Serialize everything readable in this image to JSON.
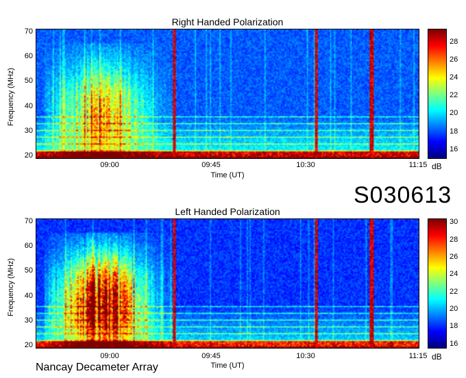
{
  "station": "Nancay Decameter Array",
  "observation_id": "S030613",
  "chart_data": [
    {
      "type": "heatmap",
      "title": "Right Handed Polarization",
      "xlabel": "Time (UT)",
      "ylabel": "Frequency (MHz)",
      "xticks": [
        "09:00",
        "09:45",
        "10:30",
        "11:15"
      ],
      "yticks": [
        20,
        30,
        40,
        50,
        60,
        70
      ],
      "ylim": [
        20,
        70
      ],
      "colorbar_unit": "dB",
      "colorbar_ticks": [
        16,
        18,
        20,
        22,
        24,
        26,
        28
      ],
      "color_range": [
        15,
        29.5
      ],
      "colormap": "jet",
      "bright_lines_time": [
        "09:25",
        "10:29",
        "10:54"
      ],
      "emission_band_mhz": [
        20,
        60
      ]
    },
    {
      "type": "heatmap",
      "title": "Left Handed Polarization",
      "xlabel": "Time (UT)",
      "ylabel": "Frequency (MHz)",
      "xticks": [
        "09:00",
        "09:45",
        "10:30",
        "11:15"
      ],
      "yticks": [
        20,
        30,
        40,
        50,
        60,
        70
      ],
      "ylim": [
        20,
        70
      ],
      "colorbar_unit": "dB",
      "colorbar_ticks": [
        16,
        18,
        20,
        22,
        24,
        26,
        28,
        30
      ],
      "color_range": [
        15.5,
        30.5
      ],
      "colormap": "jet",
      "bright_lines_time": [
        "09:25",
        "10:29",
        "10:54"
      ],
      "emission_band_mhz": [
        20,
        65
      ]
    }
  ]
}
